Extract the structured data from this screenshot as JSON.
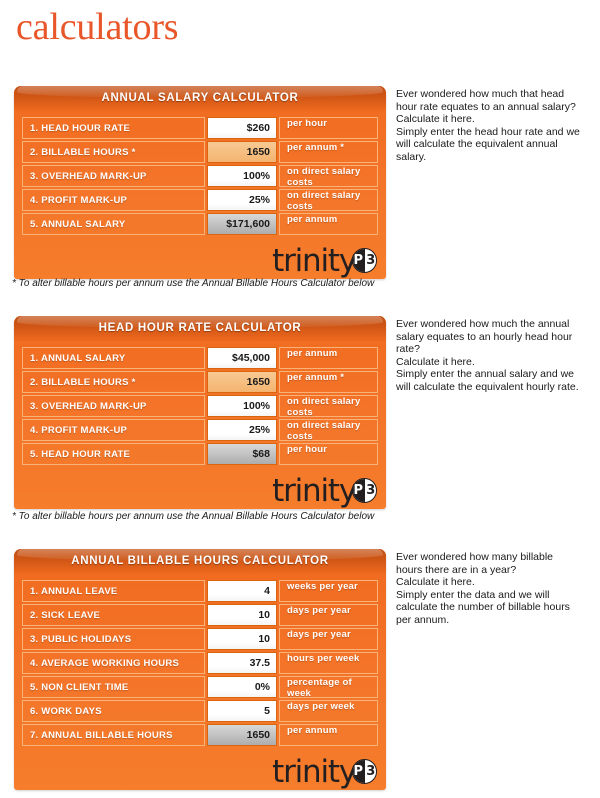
{
  "page": {
    "title": "calculators",
    "accent_color": "#e8562a",
    "panel_color": "#f4752a",
    "header_color": "#cf5515"
  },
  "logo": {
    "word": "trinity",
    "badge_left": "P",
    "badge_right": "3"
  },
  "footnotes": {
    "billable_hours_note": "* To alter billable hours per annum use the Annual Billable Hours Calculator below"
  },
  "calculators": [
    {
      "id": "annual-salary-calculator",
      "title": "ANNUAL SALARY CALCULATOR",
      "rows": [
        {
          "label": "1. HEAD HOUR RATE",
          "value": "$260",
          "unit": "per hour",
          "kind": "input"
        },
        {
          "label": "2. BILLABLE HOURS *",
          "value": "1650",
          "unit": "per annum *",
          "kind": "highlight"
        },
        {
          "label": "3. OVERHEAD MARK-UP",
          "value": "100%",
          "unit": "on direct salary costs",
          "kind": "input"
        },
        {
          "label": "4. PROFIT MARK-UP",
          "value": "25%",
          "unit": "on direct salary costs",
          "kind": "input"
        },
        {
          "label": "5. ANNUAL SALARY",
          "value": "$171,600",
          "unit": "per annum",
          "kind": "result"
        }
      ],
      "description": [
        "Ever wondered how much that head hour rate equates to an annual salary?",
        "Calculate it here.",
        "Simply enter the head hour rate and we will calculate the equivalent annual salary."
      ]
    },
    {
      "id": "head-hour-rate-calculator",
      "title": "HEAD HOUR RATE CALCULATOR",
      "rows": [
        {
          "label": "1. ANNUAL SALARY",
          "value": "$45,000",
          "unit": "per annum",
          "kind": "input"
        },
        {
          "label": "2. BILLABLE HOURS *",
          "value": "1650",
          "unit": "per annum *",
          "kind": "highlight"
        },
        {
          "label": "3. OVERHEAD MARK-UP",
          "value": "100%",
          "unit": "on direct salary costs",
          "kind": "input"
        },
        {
          "label": "4. PROFIT MARK-UP",
          "value": "25%",
          "unit": "on direct salary costs",
          "kind": "input"
        },
        {
          "label": "5. HEAD HOUR RATE",
          "value": "$68",
          "unit": "per hour",
          "kind": "result"
        }
      ],
      "description": [
        "Ever wondered how much the annual salary equates to an hourly head hour rate?",
        "Calculate it here.",
        "Simply enter the annual salary and we will calculate the equivalent hourly rate."
      ]
    },
    {
      "id": "annual-billable-hours-calculator",
      "title": "ANNUAL BILLABLE HOURS CALCULATOR",
      "rows": [
        {
          "label": "1. ANNUAL LEAVE",
          "value": "4",
          "unit": "weeks per year",
          "kind": "input"
        },
        {
          "label": "2. SICK LEAVE",
          "value": "10",
          "unit": "days per year",
          "kind": "input"
        },
        {
          "label": "3. PUBLIC HOLIDAYS",
          "value": "10",
          "unit": "days per year",
          "kind": "input"
        },
        {
          "label": "4. AVERAGE WORKING HOURS",
          "value": "37.5",
          "unit": "hours per week",
          "kind": "input"
        },
        {
          "label": "5. NON CLIENT TIME",
          "value": "0%",
          "unit": "percentage of week",
          "kind": "input"
        },
        {
          "label": "6. WORK DAYS",
          "value": "5",
          "unit": "days per week",
          "kind": "input"
        },
        {
          "label": "7. ANNUAL BILLABLE HOURS",
          "value": "1650",
          "unit": "per annum",
          "kind": "result"
        }
      ],
      "description": [
        "Ever wondered how many billable hours there are in a year?",
        "Calculate it here.",
        "Simply enter the data and we will calculate the number of billable hours per annum."
      ]
    }
  ]
}
